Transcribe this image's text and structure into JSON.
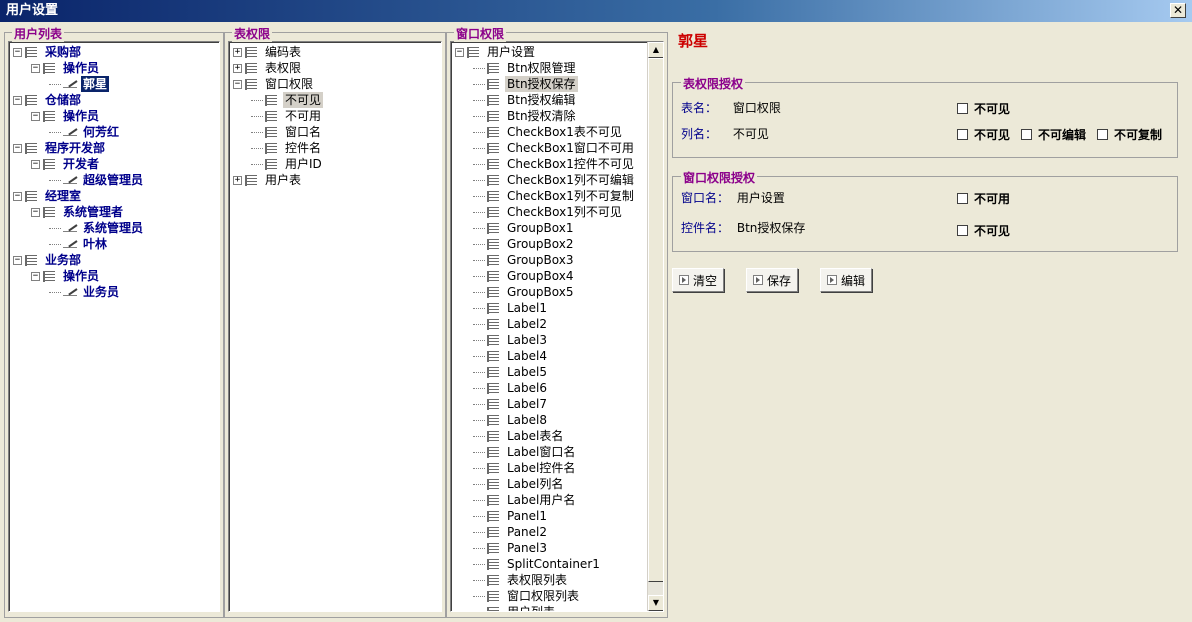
{
  "window": {
    "title": "用户设置",
    "close_label": "✕"
  },
  "user_panel": {
    "title": "用户列表",
    "tree": [
      {
        "level": 0,
        "label": "采购部",
        "icon": "list",
        "expander": "⊟",
        "style": "blue"
      },
      {
        "level": 1,
        "label": "操作员",
        "icon": "list",
        "expander": "⊟",
        "style": "blue"
      },
      {
        "level": 2,
        "label": "郭星",
        "icon": "pen",
        "style": "blue sel"
      },
      {
        "level": 0,
        "label": "仓储部",
        "icon": "list",
        "expander": "⊟",
        "style": "blue"
      },
      {
        "level": 1,
        "label": "操作员",
        "icon": "list",
        "expander": "⊟",
        "style": "blue"
      },
      {
        "level": 2,
        "label": "何芳红",
        "icon": "pen",
        "style": "blue"
      },
      {
        "level": 0,
        "label": "程序开发部",
        "icon": "list",
        "expander": "⊟",
        "style": "blue"
      },
      {
        "level": 1,
        "label": "开发者",
        "icon": "list",
        "expander": "⊟",
        "style": "blue"
      },
      {
        "level": 2,
        "label": "超级管理员",
        "icon": "pen",
        "style": "blue"
      },
      {
        "level": 0,
        "label": "经理室",
        "icon": "list",
        "expander": "⊟",
        "style": "blue"
      },
      {
        "level": 1,
        "label": "系统管理者",
        "icon": "list",
        "expander": "⊟",
        "style": "blue"
      },
      {
        "level": 2,
        "label": "系统管理员",
        "icon": "pen",
        "style": "blue"
      },
      {
        "level": 2,
        "label": "叶林",
        "icon": "pen",
        "style": "blue"
      },
      {
        "level": 0,
        "label": "业务部",
        "icon": "list",
        "expander": "⊟",
        "style": "blue"
      },
      {
        "level": 1,
        "label": "操作员",
        "icon": "list",
        "expander": "⊟",
        "style": "blue"
      },
      {
        "level": 2,
        "label": "业务员",
        "icon": "pen",
        "style": "blue"
      }
    ]
  },
  "table_panel": {
    "title": "表权限",
    "tree": [
      {
        "level": 0,
        "label": "编码表",
        "icon": "list",
        "expander": "⊞"
      },
      {
        "level": 0,
        "label": "表权限",
        "icon": "list",
        "expander": "⊞"
      },
      {
        "level": 0,
        "label": "窗口权限",
        "icon": "list",
        "expander": "⊟"
      },
      {
        "level": 1,
        "label": "不可见",
        "icon": "list",
        "style": "hl"
      },
      {
        "level": 1,
        "label": "不可用",
        "icon": "list"
      },
      {
        "level": 1,
        "label": "窗口名",
        "icon": "list"
      },
      {
        "level": 1,
        "label": "控件名",
        "icon": "list"
      },
      {
        "level": 1,
        "label": "用户ID",
        "icon": "list"
      },
      {
        "level": 0,
        "label": "用户表",
        "icon": "list",
        "expander": "⊞"
      }
    ]
  },
  "window_panel": {
    "title": "窗口权限",
    "tree": [
      {
        "level": 0,
        "label": "用户设置",
        "icon": "list",
        "expander": "⊟"
      },
      {
        "level": 1,
        "label": "Btn权限管理",
        "icon": "list"
      },
      {
        "level": 1,
        "label": "Btn授权保存",
        "icon": "list",
        "style": "hl"
      },
      {
        "level": 1,
        "label": "Btn授权编辑",
        "icon": "list"
      },
      {
        "level": 1,
        "label": "Btn授权清除",
        "icon": "list"
      },
      {
        "level": 1,
        "label": "CheckBox1表不可见",
        "icon": "list"
      },
      {
        "level": 1,
        "label": "CheckBox1窗口不可用",
        "icon": "list"
      },
      {
        "level": 1,
        "label": "CheckBox1控件不可见",
        "icon": "list"
      },
      {
        "level": 1,
        "label": "CheckBox1列不可编辑",
        "icon": "list"
      },
      {
        "level": 1,
        "label": "CheckBox1列不可复制",
        "icon": "list"
      },
      {
        "level": 1,
        "label": "CheckBox1列不可见",
        "icon": "list"
      },
      {
        "level": 1,
        "label": "GroupBox1",
        "icon": "list"
      },
      {
        "level": 1,
        "label": "GroupBox2",
        "icon": "list"
      },
      {
        "level": 1,
        "label": "GroupBox3",
        "icon": "list"
      },
      {
        "level": 1,
        "label": "GroupBox4",
        "icon": "list"
      },
      {
        "level": 1,
        "label": "GroupBox5",
        "icon": "list"
      },
      {
        "level": 1,
        "label": "Label1",
        "icon": "list"
      },
      {
        "level": 1,
        "label": "Label2",
        "icon": "list"
      },
      {
        "level": 1,
        "label": "Label3",
        "icon": "list"
      },
      {
        "level": 1,
        "label": "Label4",
        "icon": "list"
      },
      {
        "level": 1,
        "label": "Label5",
        "icon": "list"
      },
      {
        "level": 1,
        "label": "Label6",
        "icon": "list"
      },
      {
        "level": 1,
        "label": "Label7",
        "icon": "list"
      },
      {
        "level": 1,
        "label": "Label8",
        "icon": "list"
      },
      {
        "level": 1,
        "label": "Label表名",
        "icon": "list"
      },
      {
        "level": 1,
        "label": "Label窗口名",
        "icon": "list"
      },
      {
        "level": 1,
        "label": "Label控件名",
        "icon": "list"
      },
      {
        "level": 1,
        "label": "Label列名",
        "icon": "list"
      },
      {
        "level": 1,
        "label": "Label用户名",
        "icon": "list"
      },
      {
        "level": 1,
        "label": "Panel1",
        "icon": "list"
      },
      {
        "level": 1,
        "label": "Panel2",
        "icon": "list"
      },
      {
        "level": 1,
        "label": "Panel3",
        "icon": "list"
      },
      {
        "level": 1,
        "label": "SplitContainer1",
        "icon": "list"
      },
      {
        "level": 1,
        "label": "表权限列表",
        "icon": "list"
      },
      {
        "level": 1,
        "label": "窗口权限列表",
        "icon": "list"
      },
      {
        "level": 1,
        "label": "用户列表",
        "icon": "list"
      }
    ],
    "scroll_up": "▲",
    "scroll_down": "▼"
  },
  "right_panel": {
    "user_name": "郭星",
    "table_group": {
      "title": "表权限授权",
      "table_label": "表名：",
      "table_value": "窗口权限",
      "column_label": "列名：",
      "column_value": "不可见",
      "cb_table_invisible": "不可见",
      "cb_col_invisible": "不可见",
      "cb_col_noedit": "不可编辑",
      "cb_col_nocopy": "不可复制"
    },
    "window_group": {
      "title": "窗口权限授权",
      "window_label": "窗口名：",
      "window_value": "用户设置",
      "control_label": "控件名：",
      "control_value": "Btn授权保存",
      "cb_window_disabled": "不可用",
      "cb_control_invisible": "不可见"
    },
    "buttons": {
      "clear": "清空",
      "save": "保存",
      "edit": "编辑"
    }
  }
}
